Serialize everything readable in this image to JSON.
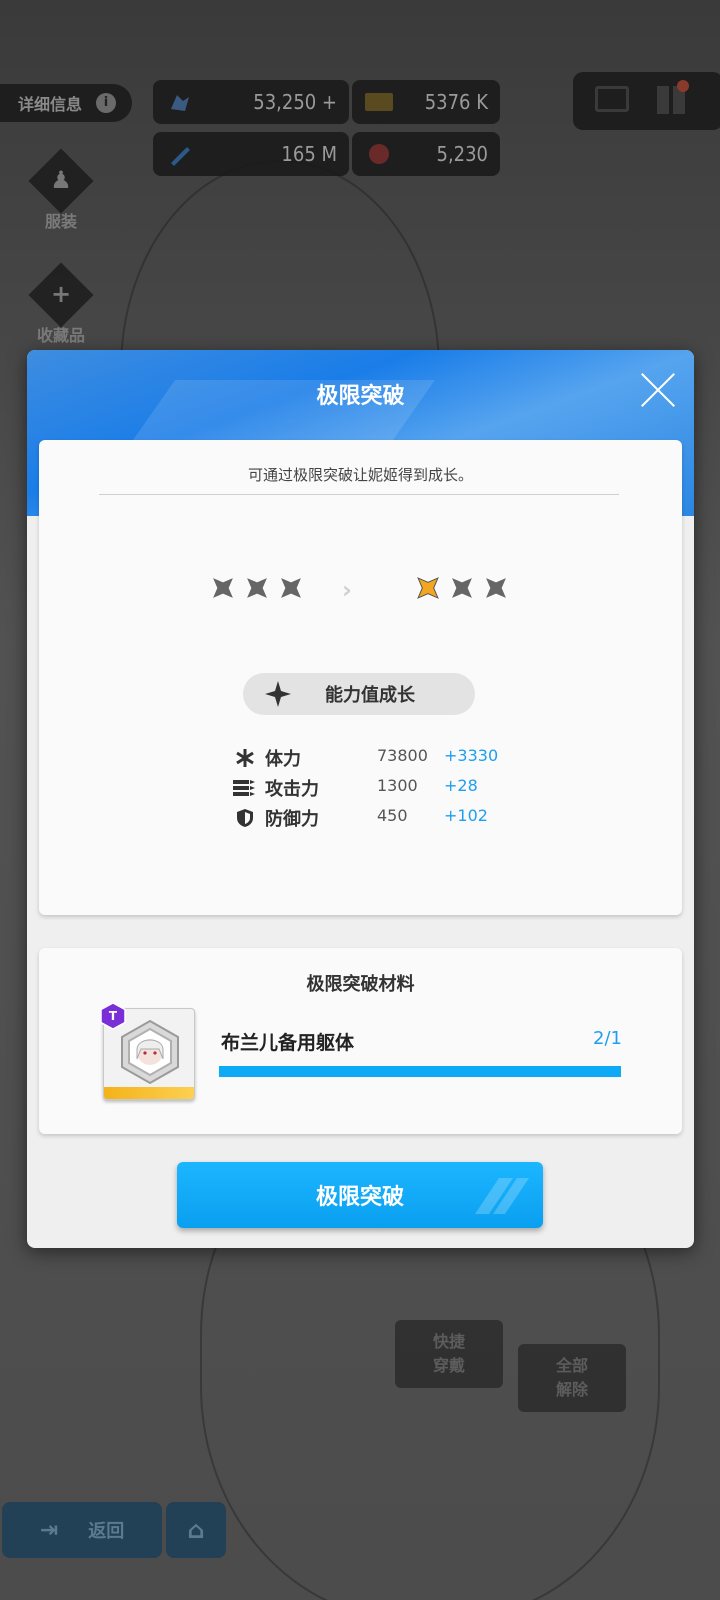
{
  "background": {
    "detail_label": "详细信息",
    "detail_info_glyph": "i",
    "resources": [
      {
        "icon": "gem-hand-icon",
        "value": "53,250 +"
      },
      {
        "icon": "credit-card-icon",
        "value": "5376 K"
      },
      {
        "icon": "syringe-icon",
        "value": "165 M"
      },
      {
        "icon": "orb-icon",
        "value": "5,230"
      }
    ],
    "side_buttons": [
      {
        "label": "服装",
        "icon": "costume-icon"
      },
      {
        "label": "收藏品",
        "icon": "collection-plus-icon"
      }
    ],
    "ghost_buttons": [
      {
        "label": "快捷\n穿戴"
      },
      {
        "label": "全部\n解除"
      }
    ],
    "back_label": "返回"
  },
  "modal": {
    "title": "极限突破",
    "description": "可通过极限突破让妮姬得到成长。",
    "stars_before": {
      "filled": 0,
      "total": 3
    },
    "stars_after": {
      "filled": 1,
      "total": 3
    },
    "growth_label": "能力值成长",
    "stats": [
      {
        "icon": "health-asterisk-icon",
        "label": "体力",
        "value": "73800",
        "delta": "+3330"
      },
      {
        "icon": "ammo-icon",
        "label": "攻击力",
        "value": "1300",
        "delta": "+28"
      },
      {
        "icon": "shield-icon",
        "label": "防御力",
        "value": "450",
        "delta": "+102"
      }
    ],
    "materials_title": "极限突破材料",
    "material": {
      "name": "布兰儿备用躯体",
      "count": "2/1",
      "progress": 1.0,
      "rarity_badge": "T"
    },
    "confirm_label": "极限突破"
  },
  "colors": {
    "accent": "#0eaaf5",
    "delta_text": "#1f9ef0",
    "star_active": "#f4a522",
    "star_inactive": "#666666",
    "header_blue": "#1a7de8"
  }
}
